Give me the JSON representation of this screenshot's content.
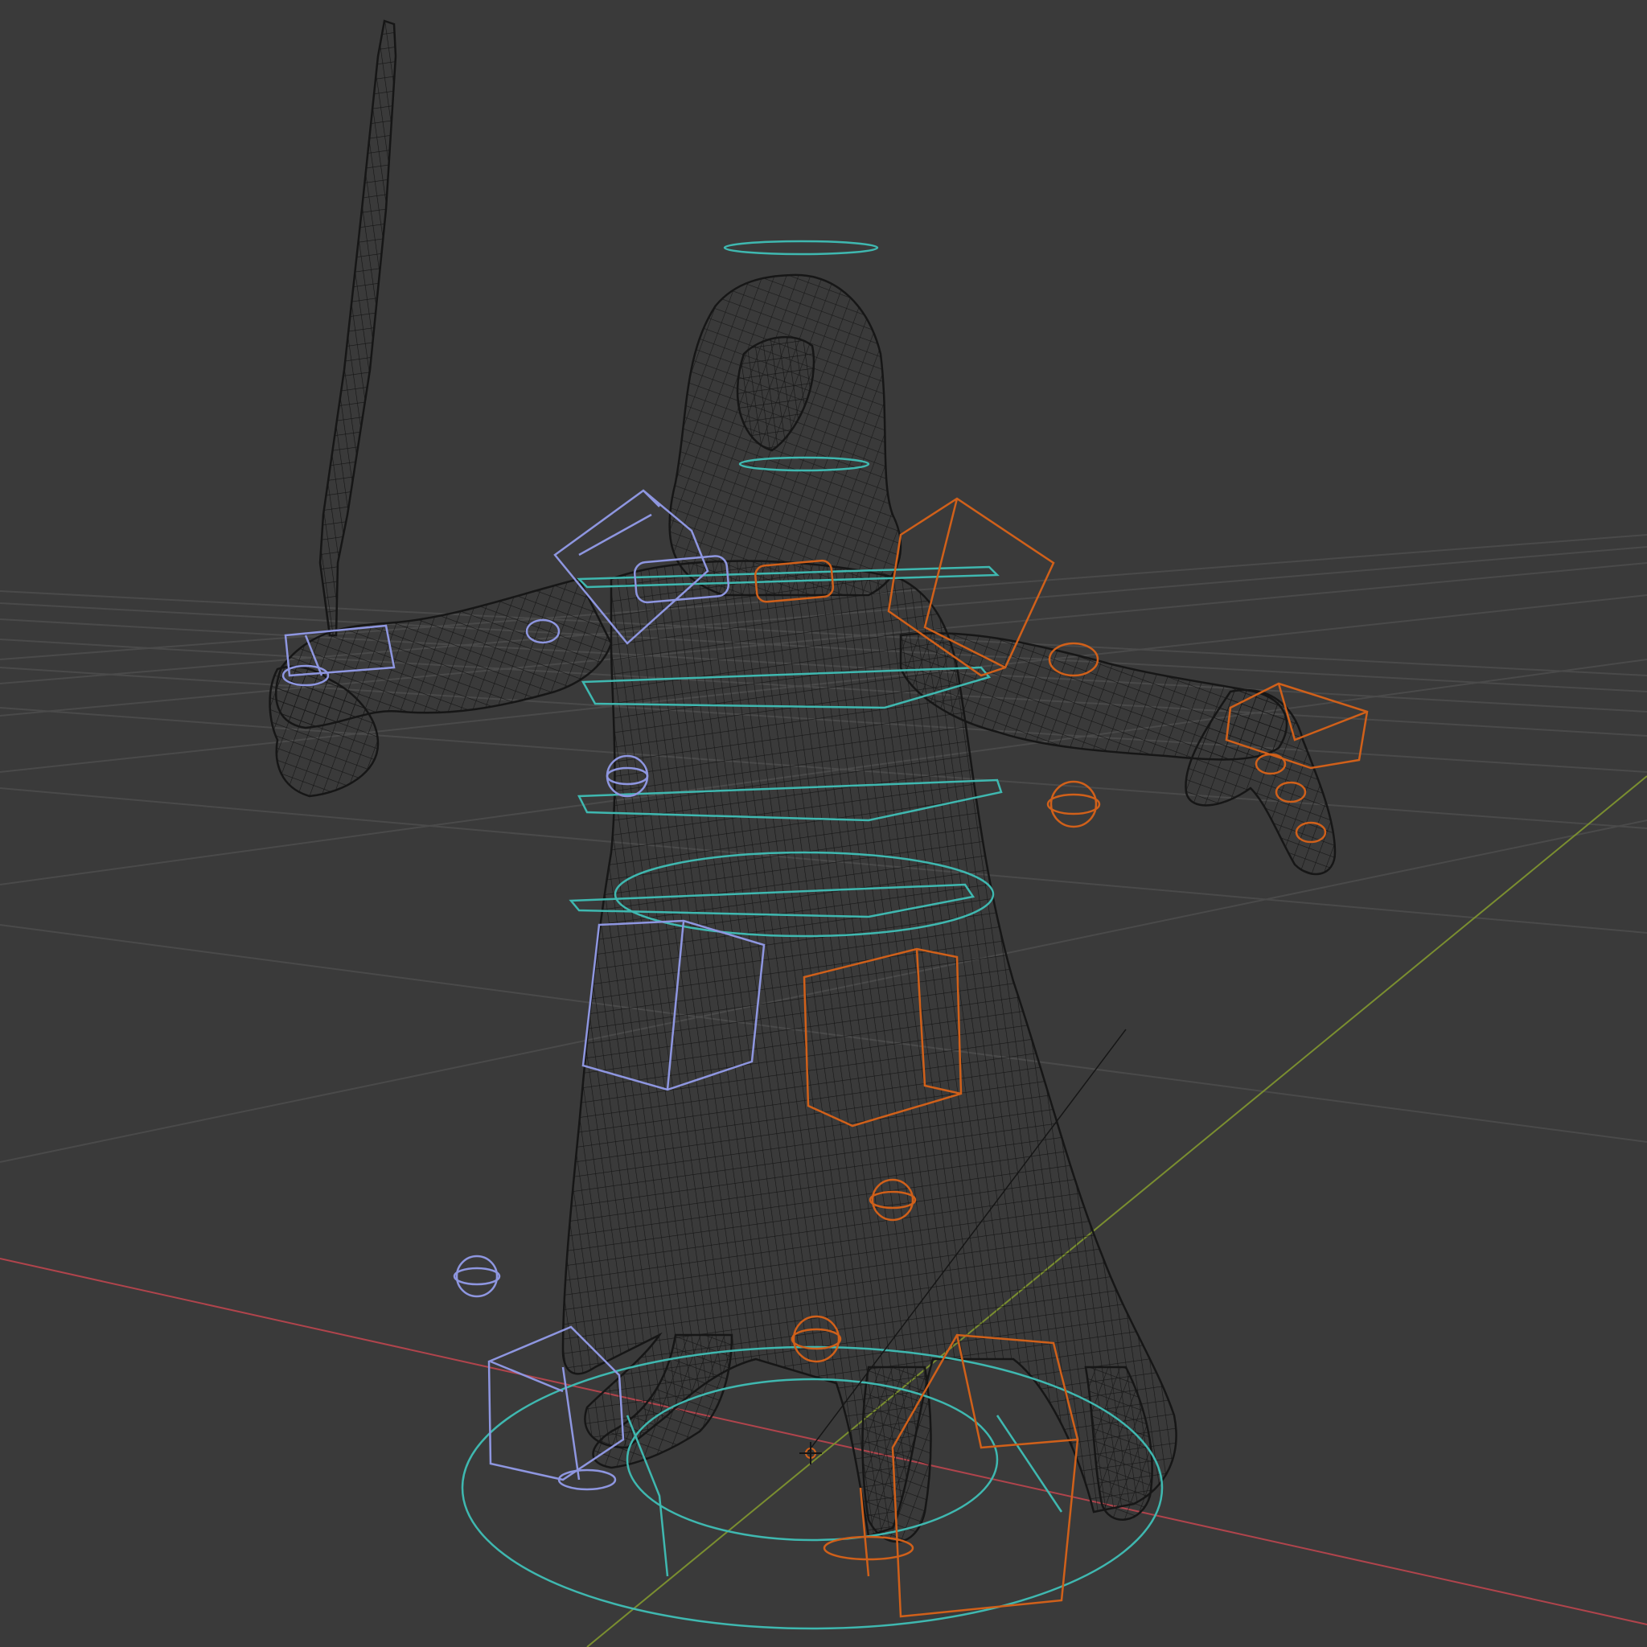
{
  "viewport": {
    "mode": "wireframe",
    "object": "hooded-figure-with-sword",
    "colors": {
      "background": "#3a3a3a",
      "grid": "#4a4a4a",
      "axis_x": "#b0444c",
      "axis_y": "#7a8e30",
      "mesh": "#161616",
      "rig_torso": "#3fb8b0",
      "rig_left": "#8e96e0",
      "rig_right": "#d0601a"
    },
    "icons": [
      "world-origin-icon",
      "pivot-point-icon"
    ]
  }
}
